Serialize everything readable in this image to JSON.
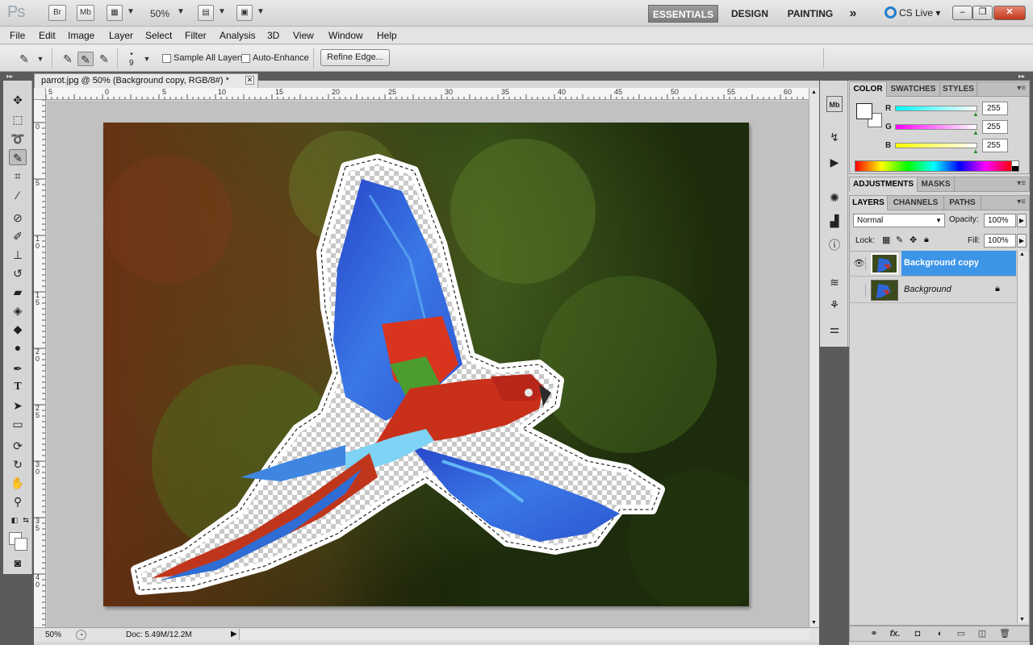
{
  "app": {
    "logo": "Ps",
    "launchers": {
      "bridge": "Br",
      "minibridge": "Mb"
    },
    "zoom": "50%",
    "workspaces": [
      {
        "label": "ESSENTIALS",
        "active": true
      },
      {
        "label": "DESIGN",
        "active": false
      },
      {
        "label": "PAINTING",
        "active": false
      }
    ],
    "more_workspaces": "»",
    "cs_live": "CS Live",
    "window_controls": {
      "minimize": "–",
      "restore": "❐",
      "close": "✕"
    }
  },
  "menu": [
    "File",
    "Edit",
    "Image",
    "Layer",
    "Select",
    "Filter",
    "Analysis",
    "3D",
    "View",
    "Window",
    "Help"
  ],
  "options": {
    "brush_size": "9",
    "sample_all_layers": "Sample All Layers",
    "sample_all_layers_checked": false,
    "auto_enhance": "Auto-Enhance",
    "auto_enhance_checked": false,
    "refine_edge": "Refine Edge..."
  },
  "document": {
    "tab_title": "parrot.jpg @ 50% (Background copy, RGB/8#) *",
    "close_glyph": "✕",
    "ruler_top": [
      "5",
      "0",
      "5",
      "10",
      "15",
      "20",
      "25",
      "30",
      "35",
      "40",
      "45",
      "50",
      "55",
      "60"
    ],
    "ruler_left": [
      "0",
      "5",
      "1 0",
      "1 5",
      "2 0",
      "2 5",
      "3 0",
      "3 5",
      "4 0"
    ],
    "status_zoom": "50%",
    "status_doc": "Doc: 5.49M/12.2M"
  },
  "color_panel": {
    "tabs": [
      "COLOR",
      "SWATCHES",
      "STYLES"
    ],
    "active_tab": "COLOR",
    "channels": [
      {
        "label": "R",
        "value": "255",
        "color": "#00ffff"
      },
      {
        "label": "G",
        "value": "255",
        "color": "#ff00ff"
      },
      {
        "label": "B",
        "value": "255",
        "color": "#ffff00"
      }
    ]
  },
  "adjustments_panel": {
    "tabs": [
      "ADJUSTMENTS",
      "MASKS"
    ]
  },
  "layers_panel": {
    "tabs": [
      "LAYERS",
      "CHANNELS",
      "PATHS"
    ],
    "blend_mode": "Normal",
    "opacity_label": "Opacity:",
    "opacity": "100%",
    "lock_label": "Lock:",
    "fill_label": "Fill:",
    "fill": "100%",
    "layers": [
      {
        "name": "Background copy",
        "selected": true,
        "visible": true,
        "locked": false
      },
      {
        "name": "Background",
        "selected": false,
        "visible": false,
        "locked": true
      }
    ],
    "bottom_icons": [
      "link-icon",
      "fx-icon",
      "mask-icon",
      "adjustment-icon",
      "folder-icon",
      "new-layer-icon",
      "trash-icon"
    ],
    "fx_text": "fx."
  },
  "colors": {
    "accent": "#3d95e8",
    "selection_row": "#3d95e8"
  }
}
